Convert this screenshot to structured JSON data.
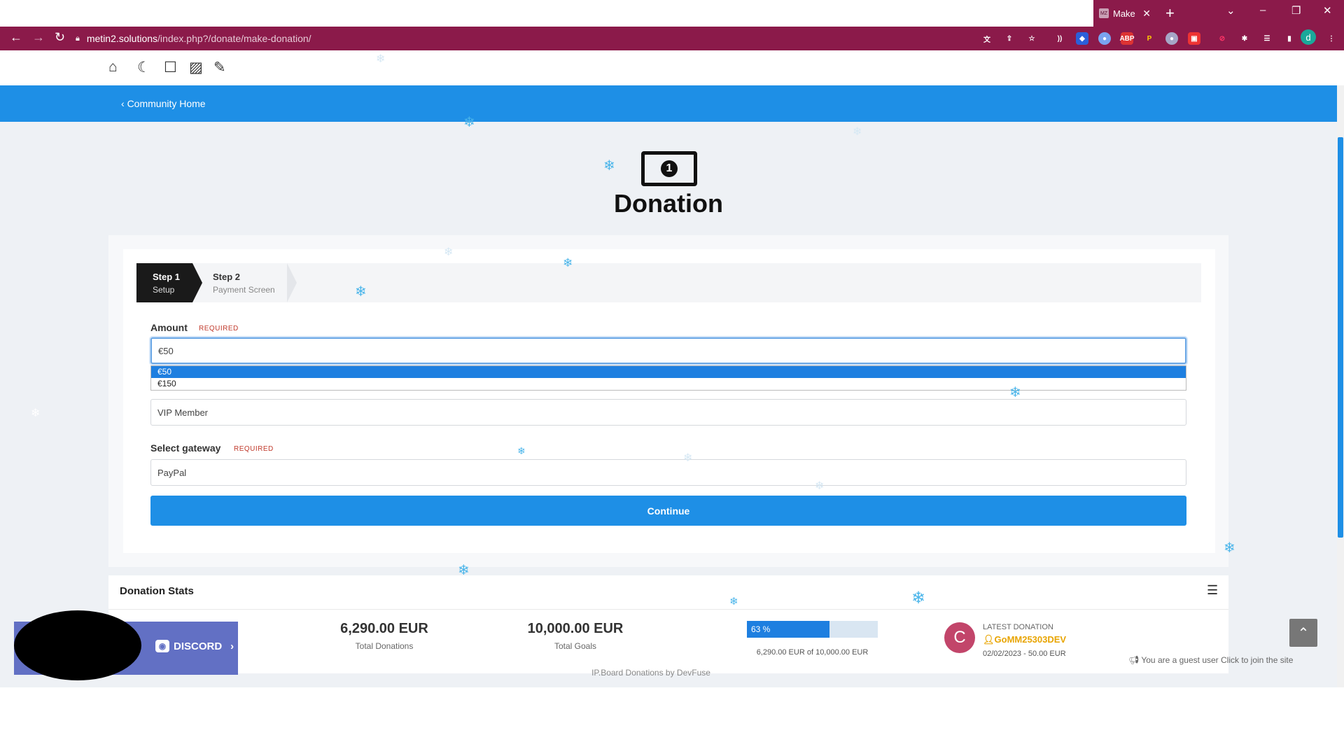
{
  "browser": {
    "tab_title": "Make",
    "tab_favicon": "MZ",
    "url_host": "metin2.solutions",
    "url_path": "/index.php?/donate/make-donation/",
    "profile_initial": "d"
  },
  "site_toolbar": {
    "icons": [
      "home-icon",
      "moon-icon",
      "square-icon",
      "image-icon",
      "brush-icon"
    ]
  },
  "breadcrumb": {
    "label": "Community Home"
  },
  "page": {
    "title": "Donation",
    "money_icon_digit": "1"
  },
  "steps": [
    {
      "title": "Step 1",
      "subtitle": "Setup"
    },
    {
      "title": "Step 2",
      "subtitle": "Payment Screen"
    }
  ],
  "form": {
    "amount_label": "Amount",
    "required_tag": "REQUIRED",
    "amount_value": "€50",
    "amount_options": [
      "€50",
      "€150"
    ],
    "goal_value": "VIP Member",
    "gateway_label": "Select gateway",
    "gateway_value": "PayPal",
    "continue_label": "Continue"
  },
  "stats": {
    "title": "Donation Stats",
    "total_donations": "6,290.00 EUR",
    "total_donations_label": "Total Donations",
    "total_goals": "10,000.00 EUR",
    "total_goals_label": "Total Goals",
    "progress_percent": 63,
    "progress_label": "63 %",
    "progress_caption": "6,290.00 EUR of 10,000.00 EUR",
    "latest_label": "LATEST DONATION",
    "latest_user": "GoMM25303DEV",
    "latest_initial": "C",
    "latest_detail": "02/02/2023 - 50.00 EUR"
  },
  "guest_notice": "You are a guest user Click to join the site",
  "footer": "IP.Board Donations by DevFuse",
  "discord": {
    "label": "DISCORD"
  },
  "colors": {
    "browser_accent": "#8b1a4a",
    "site_blue": "#1e8fe6",
    "latest_user": "#e8a400"
  }
}
